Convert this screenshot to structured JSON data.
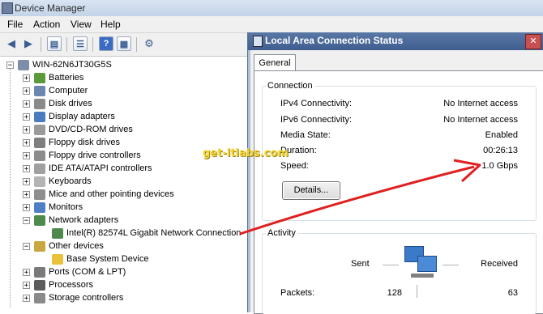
{
  "device_manager": {
    "title": "Device Manager",
    "menu": [
      "File",
      "Action",
      "View",
      "Help"
    ],
    "root": "WIN-62N6JT30G5S",
    "nodes": [
      {
        "label": "Batteries",
        "icon": "battery-icon",
        "expanded": false
      },
      {
        "label": "Computer",
        "icon": "computer-icon",
        "expanded": false
      },
      {
        "label": "Disk drives",
        "icon": "disk-drive-icon",
        "expanded": false
      },
      {
        "label": "Display adapters",
        "icon": "display-adapter-icon",
        "expanded": false
      },
      {
        "label": "DVD/CD-ROM drives",
        "icon": "dvd-drive-icon",
        "expanded": false
      },
      {
        "label": "Floppy disk drives",
        "icon": "floppy-disk-icon",
        "expanded": false
      },
      {
        "label": "Floppy drive controllers",
        "icon": "floppy-controller-icon",
        "expanded": false
      },
      {
        "label": "IDE ATA/ATAPI controllers",
        "icon": "ide-controller-icon",
        "expanded": false
      },
      {
        "label": "Keyboards",
        "icon": "keyboard-icon",
        "expanded": false
      },
      {
        "label": "Mice and other pointing devices",
        "icon": "mouse-icon",
        "expanded": false
      },
      {
        "label": "Monitors",
        "icon": "monitor-icon",
        "expanded": false
      },
      {
        "label": "Network adapters",
        "icon": "network-adapter-icon",
        "expanded": true
      },
      {
        "label": "Intel(R) 82574L Gigabit Network Connection",
        "icon": "network-card-icon",
        "child": true
      },
      {
        "label": "Other devices",
        "icon": "unknown-device-icon",
        "expanded": true
      },
      {
        "label": "Base System Device",
        "icon": "warning-device-icon",
        "child": true
      },
      {
        "label": "Ports (COM & LPT)",
        "icon": "port-icon",
        "expanded": false
      },
      {
        "label": "Processors",
        "icon": "processor-icon",
        "expanded": false
      },
      {
        "label": "Storage controllers",
        "icon": "storage-controller-icon",
        "expanded": false
      }
    ]
  },
  "dialog": {
    "title": "Local Area Connection Status",
    "tab": "General",
    "connection": {
      "heading": "Connection",
      "rows": [
        {
          "label": "IPv4 Connectivity:",
          "value": "No Internet access"
        },
        {
          "label": "IPv6 Connectivity:",
          "value": "No Internet access"
        },
        {
          "label": "Media State:",
          "value": "Enabled"
        },
        {
          "label": "Duration:",
          "value": "00:26:13"
        },
        {
          "label": "Speed:",
          "value": "1.0 Gbps"
        }
      ],
      "details_button": "Details..."
    },
    "activity": {
      "heading": "Activity",
      "sent_label": "Sent",
      "received_label": "Received",
      "packets_label": "Packets:",
      "packets_sent": "128",
      "packets_received": "63"
    }
  },
  "watermark": "get-itlabs.com",
  "colors": {
    "arrow": "#e02020",
    "dialog_title": "#3f5e8f",
    "watermark": "#f7d21c"
  }
}
